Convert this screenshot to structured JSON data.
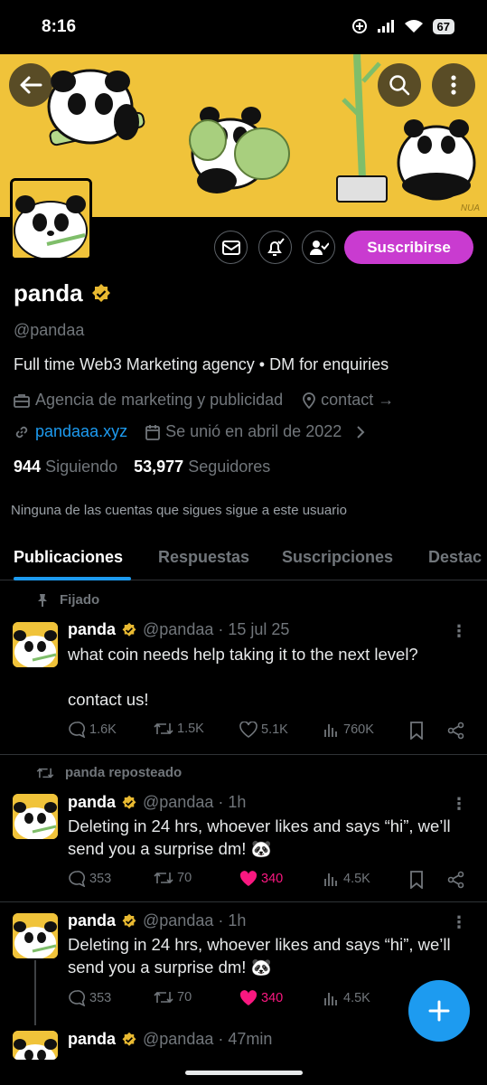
{
  "status": {
    "time": "8:16",
    "battery": "67"
  },
  "banner": {
    "signature": "NUA"
  },
  "profile": {
    "subscribe_label": "Suscribirse",
    "name": "panda",
    "handle": "@pandaa",
    "bio": "Full time Web3 Marketing agency • DM for enquiries",
    "category": "Agencia de marketing y publicidad",
    "contact": "contact →",
    "website": "pandaaa.xyz",
    "joined": "Se unió en abril de 2022",
    "following_count": "944",
    "following_label": "Siguiendo",
    "followers_count": "53,977",
    "followers_label": "Seguidores",
    "followed_by": "Ninguna de las cuentas que sigues sigue a este usuario"
  },
  "tabs": [
    "Publicaciones",
    "Respuestas",
    "Suscripciones",
    "Destac"
  ],
  "posts": [
    {
      "context": "Fijado",
      "name": "panda",
      "meta": "@pandaa · 15 jul 25",
      "text_line1": "what coin needs help taking it to the next level?",
      "text_line2": "contact us!",
      "replies": "1.6K",
      "reposts": "1.5K",
      "likes": "5.1K",
      "views": "760K"
    },
    {
      "context": "panda reposteado",
      "name": "panda",
      "meta": "@pandaa · 1h",
      "text_line1": "Deleting in 24 hrs, whoever likes and says “hi”, we’ll",
      "text_line2": "send you a surprise dm! 🐼",
      "replies": "353",
      "reposts": "70",
      "likes": "340",
      "views": "4.5K"
    },
    {
      "name": "panda",
      "meta": "@pandaa · 1h",
      "text_line1": "Deleting in 24 hrs, whoever likes and says “hi”, we’ll",
      "text_line2": "send you a surprise dm! 🐼",
      "replies": "353",
      "reposts": "70",
      "likes": "340",
      "views": "4.5K"
    },
    {
      "name": "panda",
      "meta": "@pandaa · 47min"
    }
  ],
  "colors": {
    "accent": "#1d9bf0",
    "subscribe": "#c93bd0",
    "like": "#f91880",
    "verified": "#e8b931",
    "banner": "#f0c33a"
  },
  "icons": [
    "back-arrow-icon",
    "search-icon",
    "more-vertical-icon",
    "mail-icon",
    "bell-icon",
    "follow-check-icon",
    "verified-badge-icon",
    "briefcase-icon",
    "location-icon",
    "link-icon",
    "calendar-icon",
    "pin-icon",
    "repost-icon",
    "reply-icon",
    "like-icon",
    "views-icon",
    "bookmark-icon",
    "share-icon",
    "plus-icon"
  ]
}
